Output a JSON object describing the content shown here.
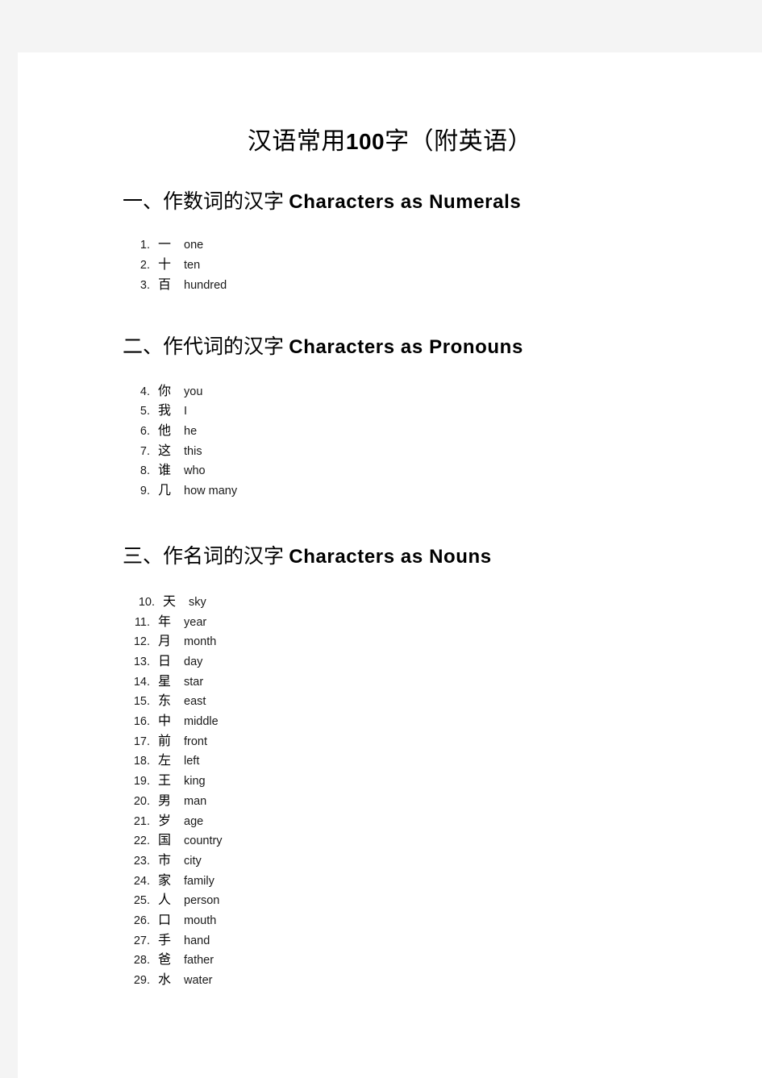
{
  "document": {
    "title_cjk_pre": "汉语常用",
    "title_number": "100",
    "title_cjk_post": "字（附英语）"
  },
  "sections": [
    {
      "heading_cjk": "一、作数词的汉字",
      "heading_en": "Characters as Numerals",
      "items": [
        {
          "num": "1.",
          "han": "一",
          "en": "one"
        },
        {
          "num": "2.",
          "han": "十",
          "en": "ten"
        },
        {
          "num": "3.",
          "han": "百",
          "en": "hundred"
        }
      ]
    },
    {
      "heading_cjk": "二、作代词的汉字",
      "heading_en": "Characters as Pronouns",
      "items": [
        {
          "num": "4.",
          "han": "你",
          "en": "you"
        },
        {
          "num": "5.",
          "han": "我",
          "en": "I"
        },
        {
          "num": "6.",
          "han": "他",
          "en": "he"
        },
        {
          "num": "7.",
          "han": "这",
          "en": "this"
        },
        {
          "num": "8.",
          "han": "谁",
          "en": "who"
        },
        {
          "num": "9.",
          "han": "几",
          "en": "how many"
        }
      ]
    },
    {
      "heading_cjk": "三、作名词的汉字",
      "heading_en": "Characters as Nouns",
      "items": [
        {
          "num": "10.",
          "han": "天",
          "en": "sky",
          "indent": true
        },
        {
          "num": "11.",
          "han": "年",
          "en": "year"
        },
        {
          "num": "12.",
          "han": "月",
          "en": "month"
        },
        {
          "num": "13.",
          "han": "日",
          "en": "day"
        },
        {
          "num": "14.",
          "han": "星",
          "en": "star"
        },
        {
          "num": "15.",
          "han": "东",
          "en": "east"
        },
        {
          "num": "16.",
          "han": "中",
          "en": "middle"
        },
        {
          "num": "17.",
          "han": "前",
          "en": "front"
        },
        {
          "num": "18.",
          "han": "左",
          "en": "left"
        },
        {
          "num": "19.",
          "han": "王",
          "en": "king"
        },
        {
          "num": "20.",
          "han": "男",
          "en": "man"
        },
        {
          "num": "21.",
          "han": "岁",
          "en": "age"
        },
        {
          "num": "22.",
          "han": "国",
          "en": "country"
        },
        {
          "num": "23.",
          "han": "市",
          "en": "city"
        },
        {
          "num": "24.",
          "han": "家",
          "en": "family"
        },
        {
          "num": "25.",
          "han": "人",
          "en": "person"
        },
        {
          "num": "26.",
          "han": "口",
          "en": "mouth"
        },
        {
          "num": "27.",
          "han": "手",
          "en": "hand"
        },
        {
          "num": "28.",
          "han": "爸",
          "en": "father"
        },
        {
          "num": "29.",
          "han": "水",
          "en": "water"
        }
      ]
    }
  ]
}
